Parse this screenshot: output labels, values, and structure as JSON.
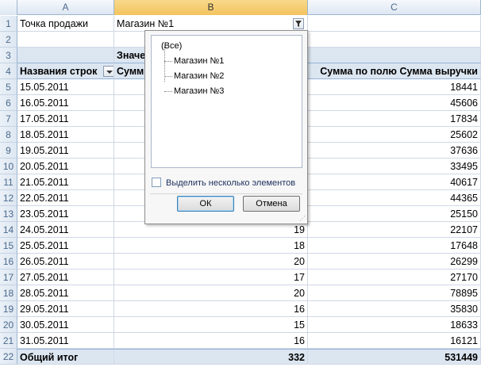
{
  "columns": [
    "A",
    "B",
    "C"
  ],
  "selected_column": "B",
  "filter_row": {
    "row_num": "1",
    "label": "Точка продажи",
    "value": "Магазин №1",
    "filter_icon": "funnel-filter-icon"
  },
  "row2": {
    "row_num": "2"
  },
  "row3": {
    "row_num": "3",
    "b": "Значе"
  },
  "header_row": {
    "row_num": "4",
    "a": "Названия строк",
    "b": "Сумм",
    "c": "Сумма по полю Сумма выручки",
    "dropdown_icon": "dropdown-arrow-icon"
  },
  "data_rows": [
    {
      "row_num": "5",
      "date": "15.05.2011",
      "b": "",
      "c": "18441"
    },
    {
      "row_num": "6",
      "date": "16.05.2011",
      "b": "",
      "c": "45606"
    },
    {
      "row_num": "7",
      "date": "17.05.2011",
      "b": "",
      "c": "17834"
    },
    {
      "row_num": "8",
      "date": "18.05.2011",
      "b": "",
      "c": "25602"
    },
    {
      "row_num": "9",
      "date": "19.05.2011",
      "b": "",
      "c": "37636"
    },
    {
      "row_num": "10",
      "date": "20.05.2011",
      "b": "",
      "c": "33495"
    },
    {
      "row_num": "11",
      "date": "21.05.2011",
      "b": "",
      "c": "40617"
    },
    {
      "row_num": "12",
      "date": "22.05.2011",
      "b": "",
      "c": "44365"
    },
    {
      "row_num": "13",
      "date": "23.05.2011",
      "b": "",
      "c": "25150"
    },
    {
      "row_num": "14",
      "date": "24.05.2011",
      "b": "19",
      "c": "22107"
    },
    {
      "row_num": "15",
      "date": "25.05.2011",
      "b": "18",
      "c": "17648"
    },
    {
      "row_num": "16",
      "date": "26.05.2011",
      "b": "20",
      "c": "26299"
    },
    {
      "row_num": "17",
      "date": "27.05.2011",
      "b": "17",
      "c": "27170"
    },
    {
      "row_num": "18",
      "date": "28.05.2011",
      "b": "20",
      "c": "78895"
    },
    {
      "row_num": "19",
      "date": "29.05.2011",
      "b": "16",
      "c": "35830"
    },
    {
      "row_num": "20",
      "date": "30.05.2011",
      "b": "15",
      "c": "18633"
    },
    {
      "row_num": "21",
      "date": "31.05.2011",
      "b": "16",
      "c": "16121"
    }
  ],
  "total_row": {
    "row_num": "22",
    "label": "Общий итог",
    "b": "332",
    "c": "531449"
  },
  "filter_popup": {
    "items": [
      "(Все)",
      "Магазин №1",
      "Магазин №2",
      "Магазин №3"
    ],
    "multi_select_label": "Выделить несколько элементов",
    "ok_label": "ОК",
    "cancel_label": "Отмена"
  },
  "colors": {
    "header_fill": "#dce6f1",
    "selected_column": "#f3c35f",
    "gridline": "#d0d7e5"
  }
}
